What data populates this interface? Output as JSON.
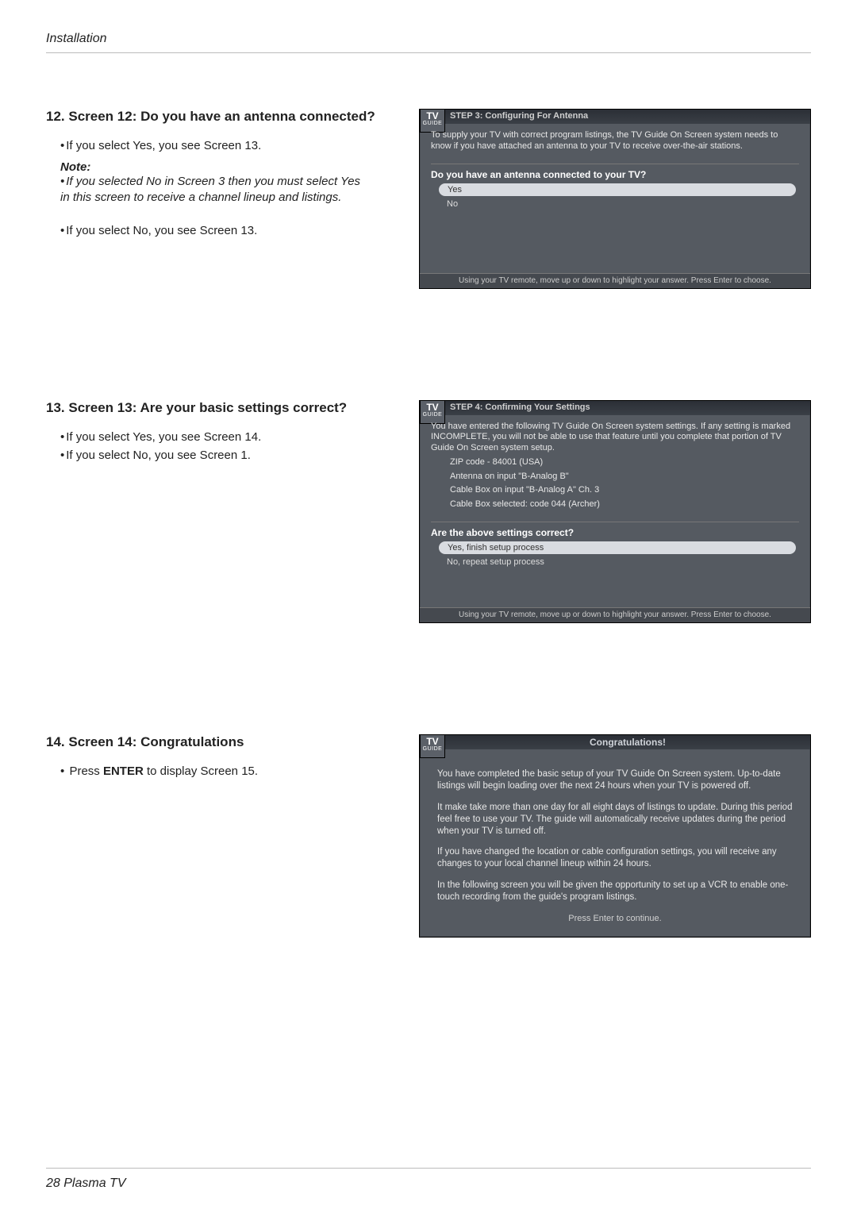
{
  "header": {
    "section_label": "Installation"
  },
  "sec12": {
    "heading": "12. Screen 12: Do you have an antenna connected?",
    "bullet_yes": "If you select Yes, you see Screen 13.",
    "note_label": "Note:",
    "note_body": "If you selected No in Screen 3 then you must select Yes in this screen to receive a channel lineup and listings.",
    "bullet_no": "If you select No, you see Screen 13.",
    "panel": {
      "step_title": "STEP 3: Configuring For Antenna",
      "intro": "To supply your TV with correct program listings, the TV Guide On Screen system needs to know if you have attached an antenna to your TV to receive over-the-air stations.",
      "question": "Do you have an antenna connected to your TV?",
      "opt_yes": "Yes",
      "opt_no": "No",
      "footer": "Using your TV remote, move up or down to highlight your answer.  Press Enter to choose."
    }
  },
  "sec13": {
    "heading": "13. Screen 13: Are your basic settings correct?",
    "bullet_yes": "If you select Yes, you see Screen 14.",
    "bullet_no": "If you select No, you see Screen 1.",
    "panel": {
      "step_title": "STEP 4: Confirming Your Settings",
      "intro": "You have entered the following TV Guide On Screen system settings. If any setting is marked INCOMPLETE, you will not be able to use that feature until you complete that portion of TV Guide On Screen system setup.",
      "line1": "ZIP code - 84001 (USA)",
      "line2": "Antenna on input \"B-Analog B\"",
      "line3": "Cable Box on input \"B-Analog A\" Ch. 3",
      "line4": "Cable Box selected: code 044 (Archer)",
      "question": "Are the above settings correct?",
      "opt_yes": "Yes, finish setup process",
      "opt_no": "No, repeat setup process",
      "footer": "Using your TV remote, move up or down to highlight your answer.  Press Enter to choose."
    }
  },
  "sec14": {
    "heading": "14. Screen 14: Congratulations",
    "bullet_pre": "Press ",
    "bullet_strong": "ENTER",
    "bullet_post": " to display Screen 15.",
    "panel": {
      "title": "Congratulations!",
      "p1": "You have completed the basic setup of your TV Guide On Screen system.  Up-to-date listings will begin loading over the next 24 hours when your TV is powered off.",
      "p2": "It make take more than one day for all eight days of listings to update.  During this period feel free to use your TV.  The guide will automatically receive updates during the period when your TV is turned off.",
      "p3": "If you have changed the location or cable configuration settings, you will receive any changes to your local channel lineup within 24 hours.",
      "p4": "In the following screen you will be given the opportunity to set up a VCR to enable one-touch recording from the guide's program listings.",
      "foot": "Press Enter to continue."
    }
  },
  "footer": {
    "page_label": "28  Plasma TV"
  },
  "logo": {
    "top": "TV",
    "bottom": "GUIDE"
  }
}
